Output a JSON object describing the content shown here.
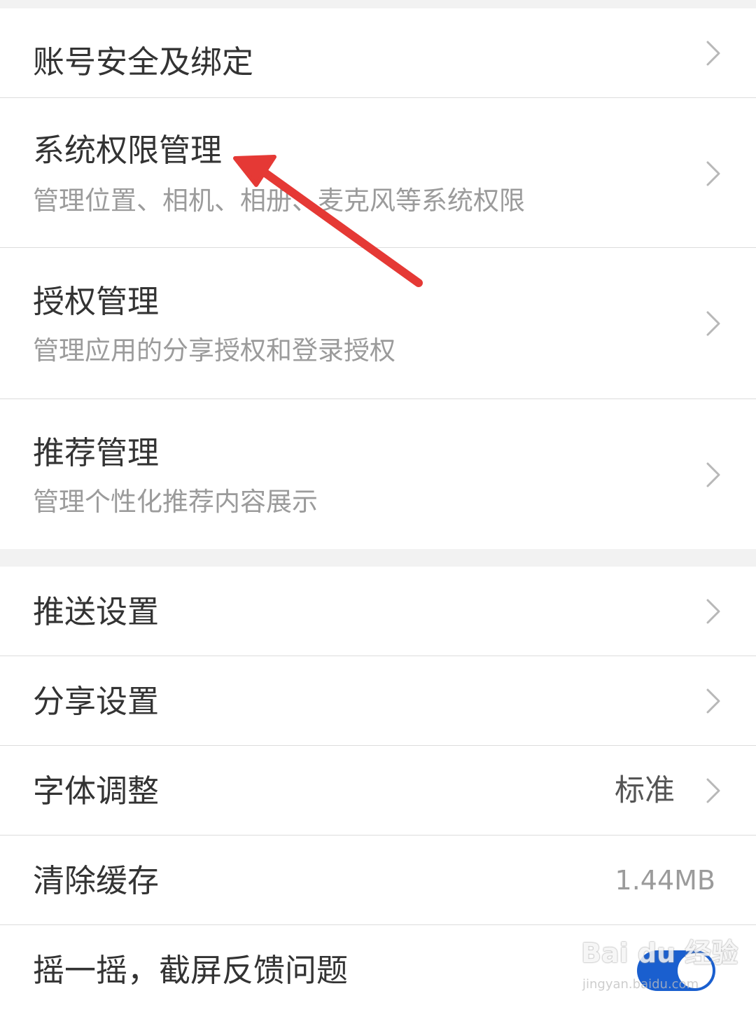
{
  "settings": {
    "group1": {
      "account_security": {
        "title": "账号安全及绑定"
      },
      "system_permissions": {
        "title": "系统权限管理",
        "subtitle": "管理位置、相机、相册、麦克风等系统权限"
      },
      "authorization": {
        "title": "授权管理",
        "subtitle": "管理应用的分享授权和登录授权"
      },
      "recommendation": {
        "title": "推荐管理",
        "subtitle": "管理个性化推荐内容展示"
      }
    },
    "group2": {
      "push": {
        "title": "推送设置"
      },
      "share": {
        "title": "分享设置"
      },
      "font": {
        "title": "字体调整",
        "value": "标准"
      },
      "cache": {
        "title": "清除缓存",
        "value": "1.44MB"
      },
      "shake": {
        "title": "摇一摇，截屏反馈问题",
        "toggle_on": true
      }
    }
  },
  "watermark": {
    "logo_text": "Bai du 经验",
    "url": "jingyan.baidu.com"
  },
  "colors": {
    "background": "#f2f2f2",
    "row": "#ffffff",
    "title_text": "#333333",
    "subtitle_text": "#9b9b9b",
    "divider": "#dcdcdc",
    "toggle_on": "#1a5fcf",
    "annotation_arrow": "#e53935"
  },
  "icons": {
    "chevron": "chevron-right-icon",
    "annotation": "red-arrow-annotation"
  }
}
